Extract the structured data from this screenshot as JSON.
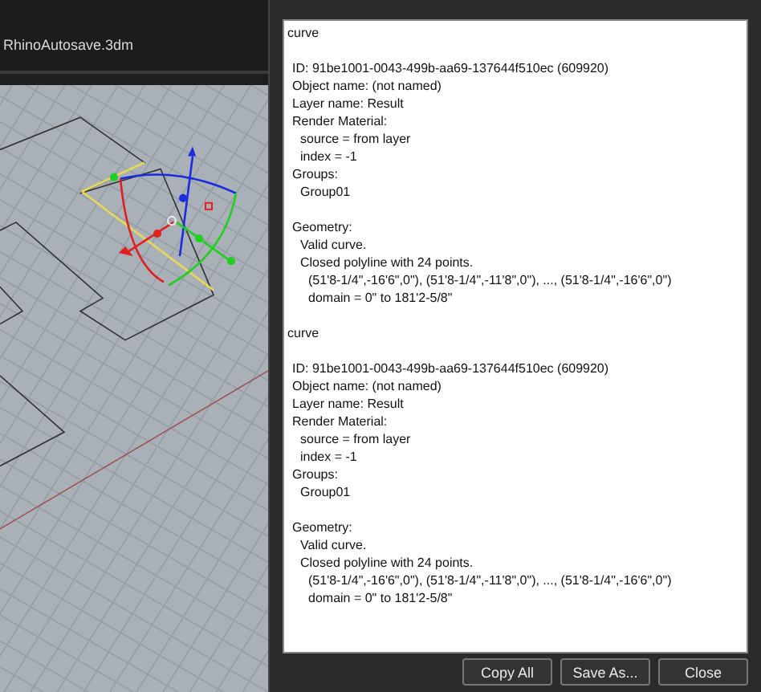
{
  "viewport": {
    "title": "RhinoAutosave.3dm"
  },
  "report": {
    "records": [
      {
        "heading": "curve",
        "sections": [
          [
            {
              "text": "ID: 91be1001-0043-499b-aa69-137644f510ec (609920)"
            },
            {
              "text": "Object name: (not named)"
            },
            {
              "text": "Layer name: Result"
            },
            {
              "text": "Render Material:",
              "children": [
                {
                  "text": "source = from layer"
                },
                {
                  "text": "index = -1"
                }
              ]
            },
            {
              "text": "Groups:",
              "children": [
                {
                  "text": "Group01"
                }
              ]
            }
          ],
          [
            {
              "text": "Geometry:",
              "children": [
                {
                  "text": "Valid curve."
                },
                {
                  "text": "Closed polyline with 24 points.",
                  "children": [
                    {
                      "text": "(51'8-1/4\",-16'6\",0\"), (51'8-1/4\",-11'8\",0\"), ..., (51'8-1/4\",-16'6\",0\")"
                    },
                    {
                      "text": "domain = 0\" to 181'2-5/8\""
                    }
                  ]
                }
              ]
            }
          ]
        ]
      },
      {
        "heading": "curve",
        "sections": [
          [
            {
              "text": "ID: 91be1001-0043-499b-aa69-137644f510ec (609920)"
            },
            {
              "text": "Object name: (not named)"
            },
            {
              "text": "Layer name: Result"
            },
            {
              "text": "Render Material:",
              "children": [
                {
                  "text": "source = from layer"
                },
                {
                  "text": "index = -1"
                }
              ]
            },
            {
              "text": "Groups:",
              "children": [
                {
                  "text": "Group01"
                }
              ]
            }
          ],
          [
            {
              "text": "Geometry:",
              "children": [
                {
                  "text": "Valid curve."
                },
                {
                  "text": "Closed polyline with 24 points.",
                  "children": [
                    {
                      "text": "(51'8-1/4\",-16'6\",0\"), (51'8-1/4\",-11'8\",0\"), ..., (51'8-1/4\",-16'6\",0\")"
                    },
                    {
                      "text": "domain = 0\" to 181'2-5/8\""
                    }
                  ]
                }
              ]
            }
          ]
        ]
      }
    ]
  },
  "buttons": [
    "Copy All",
    "Save As...",
    "Close"
  ]
}
